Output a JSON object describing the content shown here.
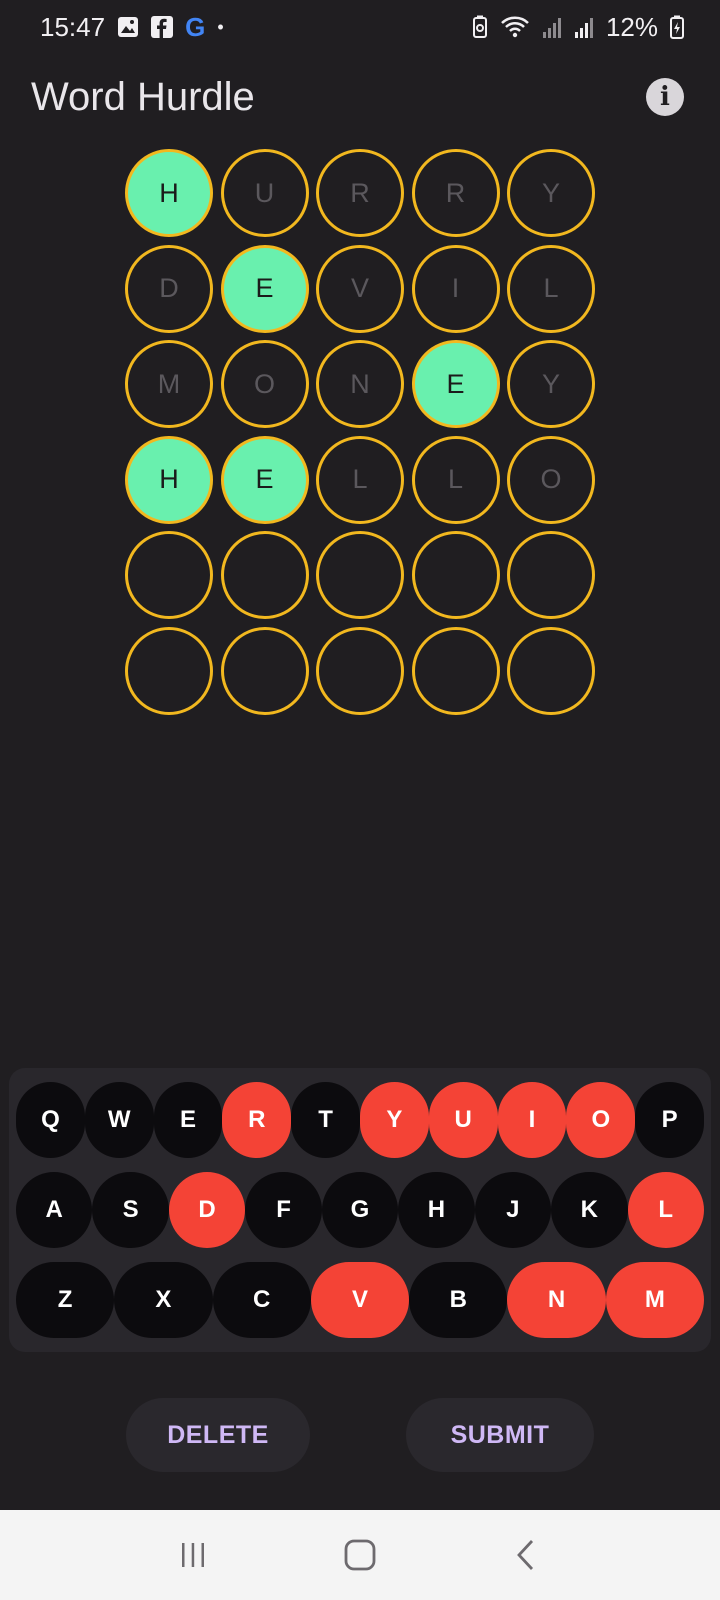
{
  "status_bar": {
    "time": "15:47",
    "google_letter": "G",
    "dot": "•",
    "battery": "12%",
    "icons": [
      "image-icon",
      "facebook-icon",
      "google-icon",
      "battery-saver-icon",
      "wifi-icon",
      "signal-icon",
      "signal-icon",
      "battery-charging-icon"
    ]
  },
  "app_bar": {
    "title": "Word Hurdle",
    "info_icon": "i"
  },
  "board": {
    "rows": [
      [
        {
          "letter": "H",
          "state": "correct"
        },
        {
          "letter": "U",
          "state": "absent"
        },
        {
          "letter": "R",
          "state": "absent"
        },
        {
          "letter": "R",
          "state": "absent"
        },
        {
          "letter": "Y",
          "state": "absent"
        }
      ],
      [
        {
          "letter": "D",
          "state": "absent"
        },
        {
          "letter": "E",
          "state": "correct"
        },
        {
          "letter": "V",
          "state": "absent"
        },
        {
          "letter": "I",
          "state": "absent"
        },
        {
          "letter": "L",
          "state": "absent"
        }
      ],
      [
        {
          "letter": "M",
          "state": "absent"
        },
        {
          "letter": "O",
          "state": "absent"
        },
        {
          "letter": "N",
          "state": "absent"
        },
        {
          "letter": "E",
          "state": "correct"
        },
        {
          "letter": "Y",
          "state": "absent"
        }
      ],
      [
        {
          "letter": "H",
          "state": "correct"
        },
        {
          "letter": "E",
          "state": "correct"
        },
        {
          "letter": "L",
          "state": "absent"
        },
        {
          "letter": "L",
          "state": "absent"
        },
        {
          "letter": "O",
          "state": "absent"
        }
      ],
      [
        {
          "letter": "",
          "state": "empty"
        },
        {
          "letter": "",
          "state": "empty"
        },
        {
          "letter": "",
          "state": "empty"
        },
        {
          "letter": "",
          "state": "empty"
        },
        {
          "letter": "",
          "state": "empty"
        }
      ],
      [
        {
          "letter": "",
          "state": "empty"
        },
        {
          "letter": "",
          "state": "empty"
        },
        {
          "letter": "",
          "state": "empty"
        },
        {
          "letter": "",
          "state": "empty"
        },
        {
          "letter": "",
          "state": "empty"
        }
      ]
    ]
  },
  "keyboard": {
    "rows": [
      [
        {
          "key": "Q",
          "state": "unused"
        },
        {
          "key": "W",
          "state": "unused"
        },
        {
          "key": "E",
          "state": "unused"
        },
        {
          "key": "R",
          "state": "absent"
        },
        {
          "key": "T",
          "state": "unused"
        },
        {
          "key": "Y",
          "state": "absent"
        },
        {
          "key": "U",
          "state": "absent"
        },
        {
          "key": "I",
          "state": "absent"
        },
        {
          "key": "O",
          "state": "absent"
        },
        {
          "key": "P",
          "state": "unused"
        }
      ],
      [
        {
          "key": "A",
          "state": "unused"
        },
        {
          "key": "S",
          "state": "unused"
        },
        {
          "key": "D",
          "state": "absent"
        },
        {
          "key": "F",
          "state": "unused"
        },
        {
          "key": "G",
          "state": "unused"
        },
        {
          "key": "H",
          "state": "unused"
        },
        {
          "key": "J",
          "state": "unused"
        },
        {
          "key": "K",
          "state": "unused"
        },
        {
          "key": "L",
          "state": "absent"
        }
      ],
      [
        {
          "key": "Z",
          "state": "unused"
        },
        {
          "key": "X",
          "state": "unused"
        },
        {
          "key": "C",
          "state": "unused"
        },
        {
          "key": "V",
          "state": "absent"
        },
        {
          "key": "B",
          "state": "unused"
        },
        {
          "key": "N",
          "state": "absent"
        },
        {
          "key": "M",
          "state": "absent"
        }
      ]
    ]
  },
  "actions": {
    "delete_label": "DELETE",
    "submit_label": "SUBMIT"
  },
  "nav_bar": {
    "icons": [
      "recent-apps-icon",
      "home-icon",
      "back-icon"
    ]
  },
  "colors": {
    "background": "#201e21",
    "tile_border": "#f2b81f",
    "correct": "#69f0ae",
    "absent_key": "#f44336",
    "key": "#0c0b0e",
    "action_text": "#cfb8f5"
  }
}
